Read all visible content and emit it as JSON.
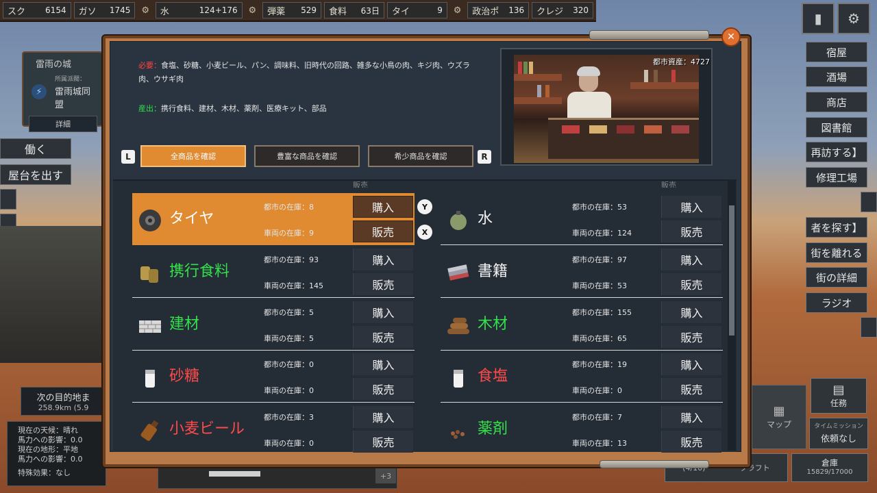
{
  "resources": [
    {
      "label": "スク",
      "value": "6154"
    },
    {
      "label": "ガソ",
      "value": "1745"
    },
    {
      "label": "水",
      "value": "124+176"
    },
    {
      "label": "弾薬",
      "value": "529"
    },
    {
      "label": "食料",
      "value": "63日"
    },
    {
      "label": "タイ",
      "value": "9"
    },
    {
      "label": "政治ポ",
      "value": "136"
    },
    {
      "label": "クレジ",
      "value": "320"
    }
  ],
  "city": {
    "name": "雷雨の城",
    "affiliation_label": "所属派閥：",
    "affiliation": "雷雨城同盟",
    "detail_button": "詳細"
  },
  "left_buttons": {
    "work": "働く",
    "stall": "屋台を出す"
  },
  "destination": {
    "title": "次の目的地ま",
    "distance": "258.9km (5.9"
  },
  "weather": {
    "line1": "現在の天候：晴れ",
    "line2": "馬力への影響：0.0",
    "line3": "現在の地形：平地",
    "line4": "馬力への影響：0.0",
    "line5": "特殊効果：なし"
  },
  "right_menu": [
    "宿屋",
    "酒場",
    "商店",
    "図書館",
    "再訪する】",
    "修理工場",
    "者を探す】",
    "街を離れる",
    "街の詳細",
    "ラジオ"
  ],
  "bottom_right": {
    "map": "マップ",
    "task": "任務",
    "time_title": "タイムミッション",
    "time_value": "依頼なし",
    "storage": "倉庫",
    "storage_value": "15829/17000",
    "craft": "クラフト",
    "count": "(4/10)"
  },
  "hud": {
    "plus": "+3"
  },
  "shop": {
    "need_label": "必要：",
    "need_text": "食塩、砂糖、小麦ビール、パン、調味料、旧時代の回路、雑多な小鳥の肉、キジ肉、ウズラ肉、ウサギ肉",
    "output_label": "産出：",
    "output_text": "携行食料、建材、木材、薬剤、医療キット、部品",
    "city_wealth": "都市資産：4727",
    "tabs": {
      "key_left": "L",
      "key_right": "R",
      "all": "全商品を確認",
      "plenty": "豊富な商品を確認",
      "rare": "希少商品を確認"
    },
    "gamepad": {
      "y": "Y",
      "x": "X"
    },
    "partial_top": {
      "buy": "購入",
      "sell": "販売"
    },
    "items_left": [
      {
        "name": "タイヤ",
        "icon": "tire-icon",
        "city": "都市の在庫：8",
        "car": "車両の在庫：9",
        "buy": "購入",
        "sell": "販売",
        "selected": true,
        "color": "white"
      },
      {
        "name": "携行食料",
        "icon": "canned-food-icon",
        "city": "都市の在庫：93",
        "car": "車両の在庫：145",
        "buy": "購入",
        "sell": "販売",
        "color": "green"
      },
      {
        "name": "建材",
        "icon": "bricks-icon",
        "city": "都市の在庫：5",
        "car": "車両の在庫：5",
        "buy": "購入",
        "sell": "販売",
        "color": "green"
      },
      {
        "name": "砂糖",
        "icon": "sugar-jar-icon",
        "city": "都市の在庫：0",
        "car": "車両の在庫：0",
        "buy": "購入",
        "sell": "販売",
        "color": "red"
      },
      {
        "name": "小麦ビール",
        "icon": "beer-bottle-icon",
        "city": "都市の在庫：3",
        "car": "車両の在庫：0",
        "buy": "購入",
        "sell": "販売",
        "color": "red"
      }
    ],
    "items_right": [
      {
        "name": "水",
        "icon": "canteen-icon",
        "city": "都市の在庫：53",
        "car": "車両の在庫：124",
        "buy": "購入",
        "sell": "販売",
        "color": "white"
      },
      {
        "name": "書籍",
        "icon": "books-icon",
        "city": "都市の在庫：97",
        "car": "車両の在庫：53",
        "buy": "購入",
        "sell": "販売",
        "color": "white"
      },
      {
        "name": "木材",
        "icon": "logs-icon",
        "city": "都市の在庫：155",
        "car": "車両の在庫：65",
        "buy": "購入",
        "sell": "販売",
        "color": "green"
      },
      {
        "name": "食塩",
        "icon": "salt-jar-icon",
        "city": "都市の在庫：19",
        "car": "車両の在庫：0",
        "buy": "購入",
        "sell": "販売",
        "color": "red"
      },
      {
        "name": "薬剤",
        "icon": "pills-icon",
        "city": "都市の在庫：7",
        "car": "車両の在庫：13",
        "buy": "購入",
        "sell": "販売",
        "color": "green"
      }
    ]
  }
}
